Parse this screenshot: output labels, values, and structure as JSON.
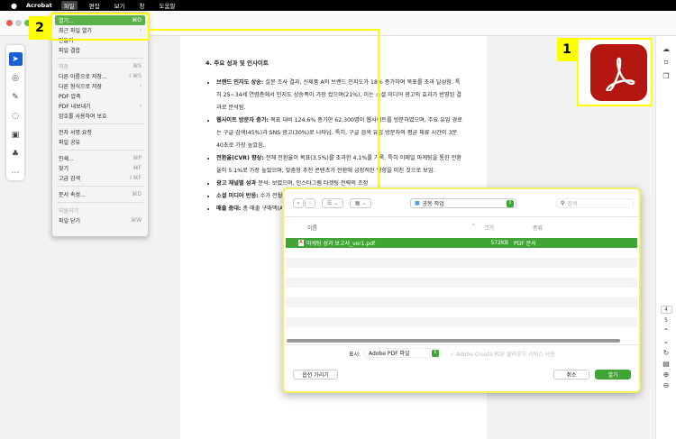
{
  "menubar": {
    "apple": "",
    "app": "Acrobat",
    "items": [
      "파일",
      "편집",
      "보기",
      "창",
      "도움말"
    ]
  },
  "file_menu": {
    "items": [
      {
        "label": "열기...",
        "shortcut": "⌘O",
        "state": "highlight"
      },
      {
        "label": "최근 파일 열기",
        "shortcut": "›"
      },
      {
        "label": "만들기",
        "shortcut": "›"
      },
      {
        "label": "파일 결합",
        "shortcut": ""
      },
      {
        "sep": true
      },
      {
        "label": "저장",
        "shortcut": "⌘S",
        "state": "disabled"
      },
      {
        "label": "다른 이름으로 저장...",
        "shortcut": "⇧⌘S"
      },
      {
        "label": "다른 형식으로 저장",
        "shortcut": "›"
      },
      {
        "label": "PDF 압축",
        "shortcut": ""
      },
      {
        "label": "PDF 내보내기",
        "shortcut": "›"
      },
      {
        "label": "암호를 사용하여 보호",
        "shortcut": ""
      },
      {
        "sep": true
      },
      {
        "label": "전자 서명 요청",
        "shortcut": ""
      },
      {
        "label": "파일 공유",
        "shortcut": ""
      },
      {
        "sep": true
      },
      {
        "label": "인쇄...",
        "shortcut": "⌘P"
      },
      {
        "label": "찾기",
        "shortcut": "⌘F"
      },
      {
        "label": "고급 검색",
        "shortcut": "⇧⌘F"
      },
      {
        "sep": true
      },
      {
        "label": "문서 속성...",
        "shortcut": "⌘D"
      },
      {
        "sep": true
      },
      {
        "label": "되돌리기",
        "shortcut": "",
        "state": "disabled"
      },
      {
        "label": "파일 닫기",
        "shortcut": "⌘W"
      }
    ]
  },
  "callouts": {
    "one": "1",
    "two": "2"
  },
  "document": {
    "heading": "4. 주요 성과 및 인사이트",
    "bullets": [
      {
        "title": "브랜드 인지도 상승:",
        "text": " 설문 조사 결과, 신제품 A의 브랜드 인지도가 18% 증가하여 목표를 초과 달성함. 특히 25~34세 연령층에서 인지도 상승폭이 가장 컸으며(21%), 이는 소셜 미디어 광고의 효과가 반영된 결과로 분석됨."
      },
      {
        "title": "웹사이트 방문자 증가:",
        "text": " 목표 대비 124.6% 증가한 62,300명이 웹사이트를 방문하였으며, 주요 유입 경로는 구글 검색(45%)과 SNS 광고(30%)로 나타남. 특히, 구글 검색 유입 방문자의 평균 체류 시간이 3분 40초로 가장 높았음."
      },
      {
        "title": "전환율(CVR) 향상:",
        "text": " 전체 전환율이 목표(3.5%)를 초과한 4.1%를 기록. 특히 이메일 마케팅을 통한 전환율이 5.1%로 가장 높았으며, 맞춤형 추천 콘텐츠가 전환에 긍정적인 영향을 미친 것으로 보임."
      },
      {
        "title": "광고 채널별 성과 ",
        "text": "분석: 보였으며, 인스타그램 타겟팅 전략의 조정"
      },
      {
        "title": "소셜 미디어 반응:",
        "text": " 수가 전월 대비 40% 가장 높았음."
      },
      {
        "title": "매출 증대:",
        "text": " 총 매출 구매액(AOV)이 20% 작용한 것으로 분석됨."
      }
    ]
  },
  "rightbar": {
    "page_current": "4",
    "page_next": "5"
  },
  "dialog": {
    "location": "공동 작업",
    "search_placeholder": "검색",
    "columns": {
      "name": "이름",
      "size": "크기",
      "kind": "종류"
    },
    "files": [
      {
        "name": "마케팅 성과 보고서_ver1.pdf",
        "size": "572KB",
        "kind": "PDF 문서"
      }
    ],
    "show_label": "표시:",
    "show_value": "Adobe PDF 파일",
    "cloud_option": "Adobe Create PDF 클라우드 서비스 사용",
    "options_button": "옵션 가리기",
    "cancel_button": "취소",
    "open_button": "열기",
    "accent": "#3fa535"
  }
}
